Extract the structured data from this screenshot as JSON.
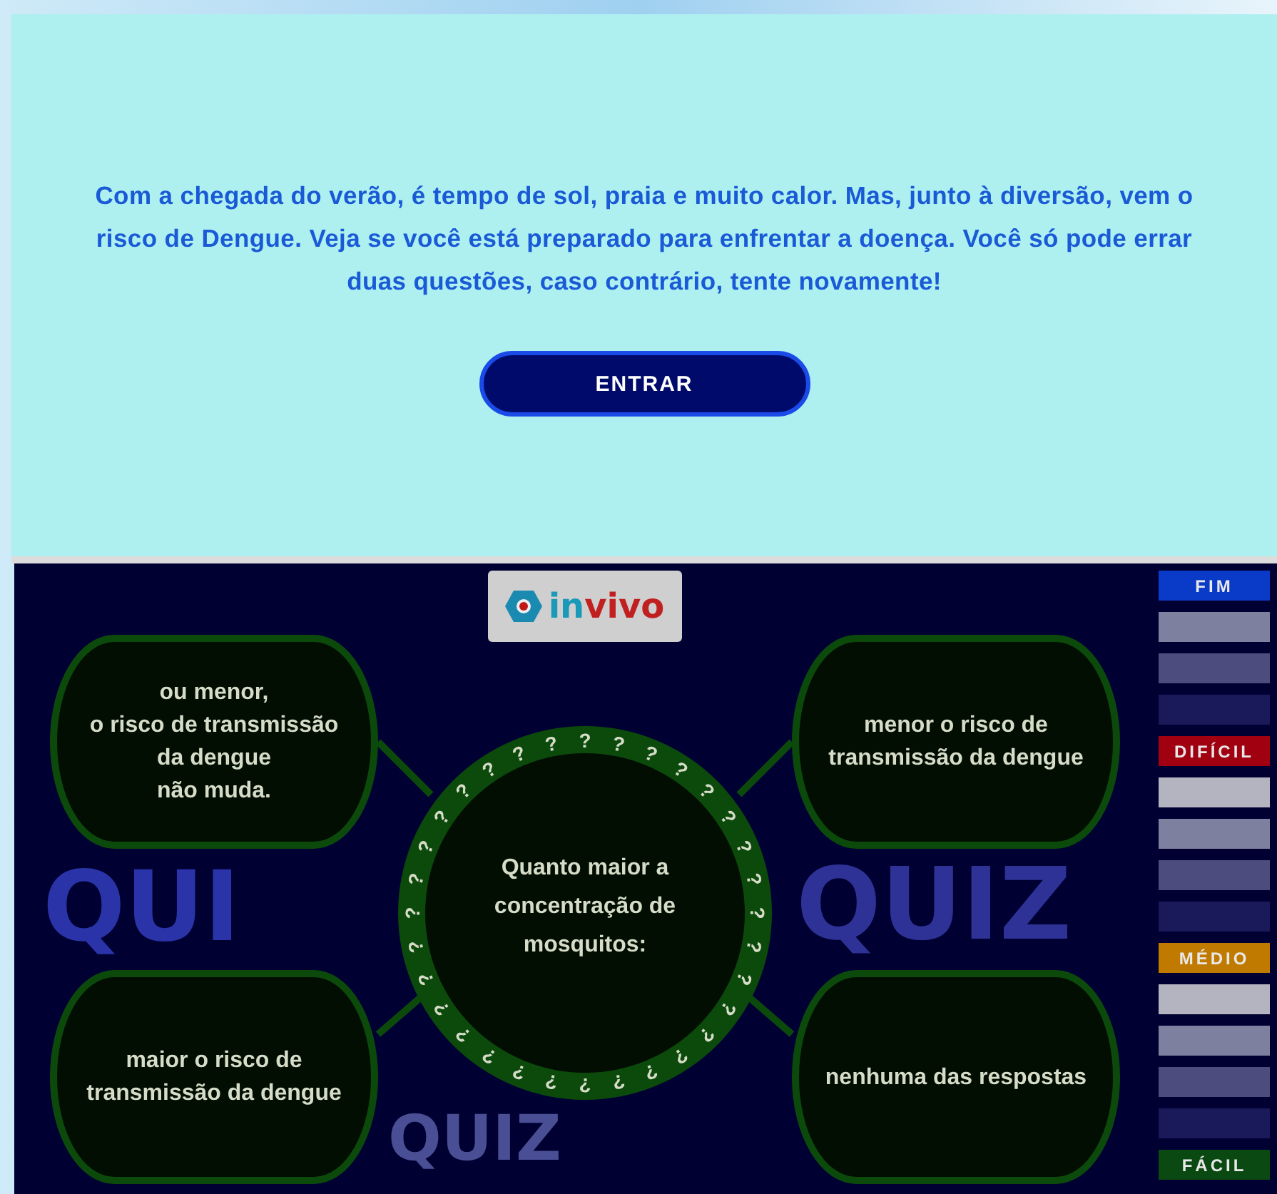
{
  "intro": {
    "text": "Com a chegada do verão, é tempo de sol, praia e muito calor. Mas, junto à diversão, vem o risco de Dengue. Veja se você está preparado para enfrentar a doença. Você só pode errar duas questões, caso contrário, tente novamente!",
    "button": "ENTRAR"
  },
  "quiz": {
    "logo": {
      "first": "in",
      "second": "vivo"
    },
    "background_words": [
      "QUI",
      "QUIZ",
      "QUIZ"
    ],
    "question": "Quanto maior a\nconcentração de\nmosquitos:",
    "ring_marks": [
      "?",
      "?",
      "?",
      "?",
      "?",
      "?",
      "?",
      "?",
      "?",
      "?",
      "?",
      "?",
      "?",
      "?",
      "?",
      "?",
      "?",
      "?",
      "?",
      "?",
      "?",
      "?",
      "?",
      "?",
      "?",
      "?",
      "?",
      "?",
      "?",
      "?",
      "?",
      "?"
    ],
    "answers": [
      {
        "text": "ou menor,\no risco de transmissão\nda dengue\nnão muda."
      },
      {
        "text": "menor o risco de\ntransmissão da dengue"
      },
      {
        "text": "maior o risco de\ntransmissão da dengue"
      },
      {
        "text": "nenhuma das respostas"
      }
    ],
    "ladder": [
      {
        "kind": "label",
        "label": "FIM",
        "color": "#0a3ac8"
      },
      {
        "kind": "rung",
        "color": "#7e80a0"
      },
      {
        "kind": "rung",
        "color": "#4c4c7e"
      },
      {
        "kind": "rung",
        "color": "#1a1a5a"
      },
      {
        "kind": "label",
        "label": "DIFÍCIL",
        "color": "#a00010"
      },
      {
        "kind": "rung",
        "color": "#b4b4c0"
      },
      {
        "kind": "rung",
        "color": "#7e80a0"
      },
      {
        "kind": "rung",
        "color": "#4c4c7e"
      },
      {
        "kind": "rung",
        "color": "#1a1a5a"
      },
      {
        "kind": "label",
        "label": "MÉDIO",
        "color": "#c07a00"
      },
      {
        "kind": "rung",
        "color": "#b4b4c0"
      },
      {
        "kind": "rung",
        "color": "#7e80a0"
      },
      {
        "kind": "rung",
        "color": "#4c4c7e"
      },
      {
        "kind": "rung",
        "color": "#1a1a5a"
      },
      {
        "kind": "label",
        "label": "FÁCIL",
        "color": "#0a4a12"
      }
    ]
  }
}
